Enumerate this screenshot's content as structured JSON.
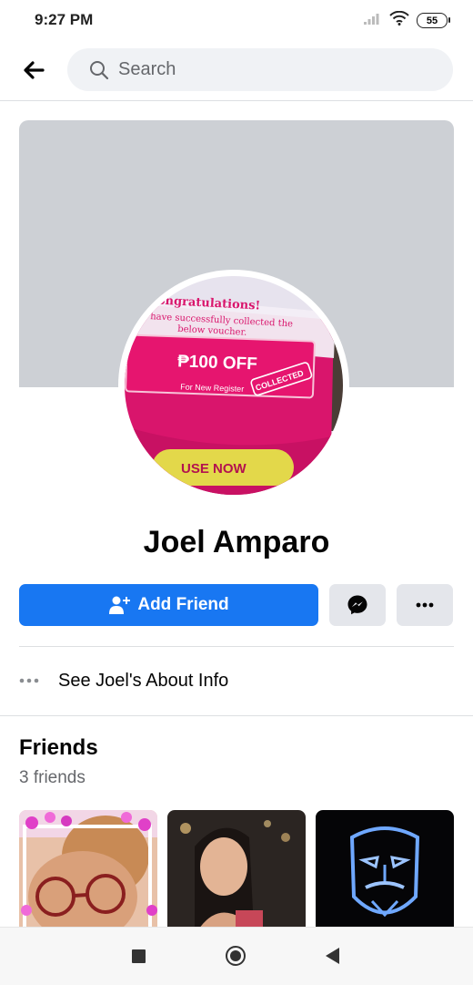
{
  "status_bar": {
    "time": "9:27 PM",
    "battery": "55"
  },
  "top_bar": {
    "search_placeholder": "Search"
  },
  "profile": {
    "name": "Joel Amparo",
    "avatar_text": {
      "line1": "Congratulations!",
      "line2": "have successfully collected the",
      "line3": "below voucher.",
      "amount": "₱100 OFF",
      "sub": "For New Register",
      "stamp": "COLLECTED",
      "cta": "USE NOW"
    }
  },
  "actions": {
    "add_friend": "Add Friend"
  },
  "about": {
    "label": "See Joel's About Info"
  },
  "friends": {
    "title": "Friends",
    "count": "3 friends"
  },
  "colors": {
    "primary": "#1877f2",
    "cover": "#cdd0d5",
    "secondary_button": "#e4e6eb"
  }
}
